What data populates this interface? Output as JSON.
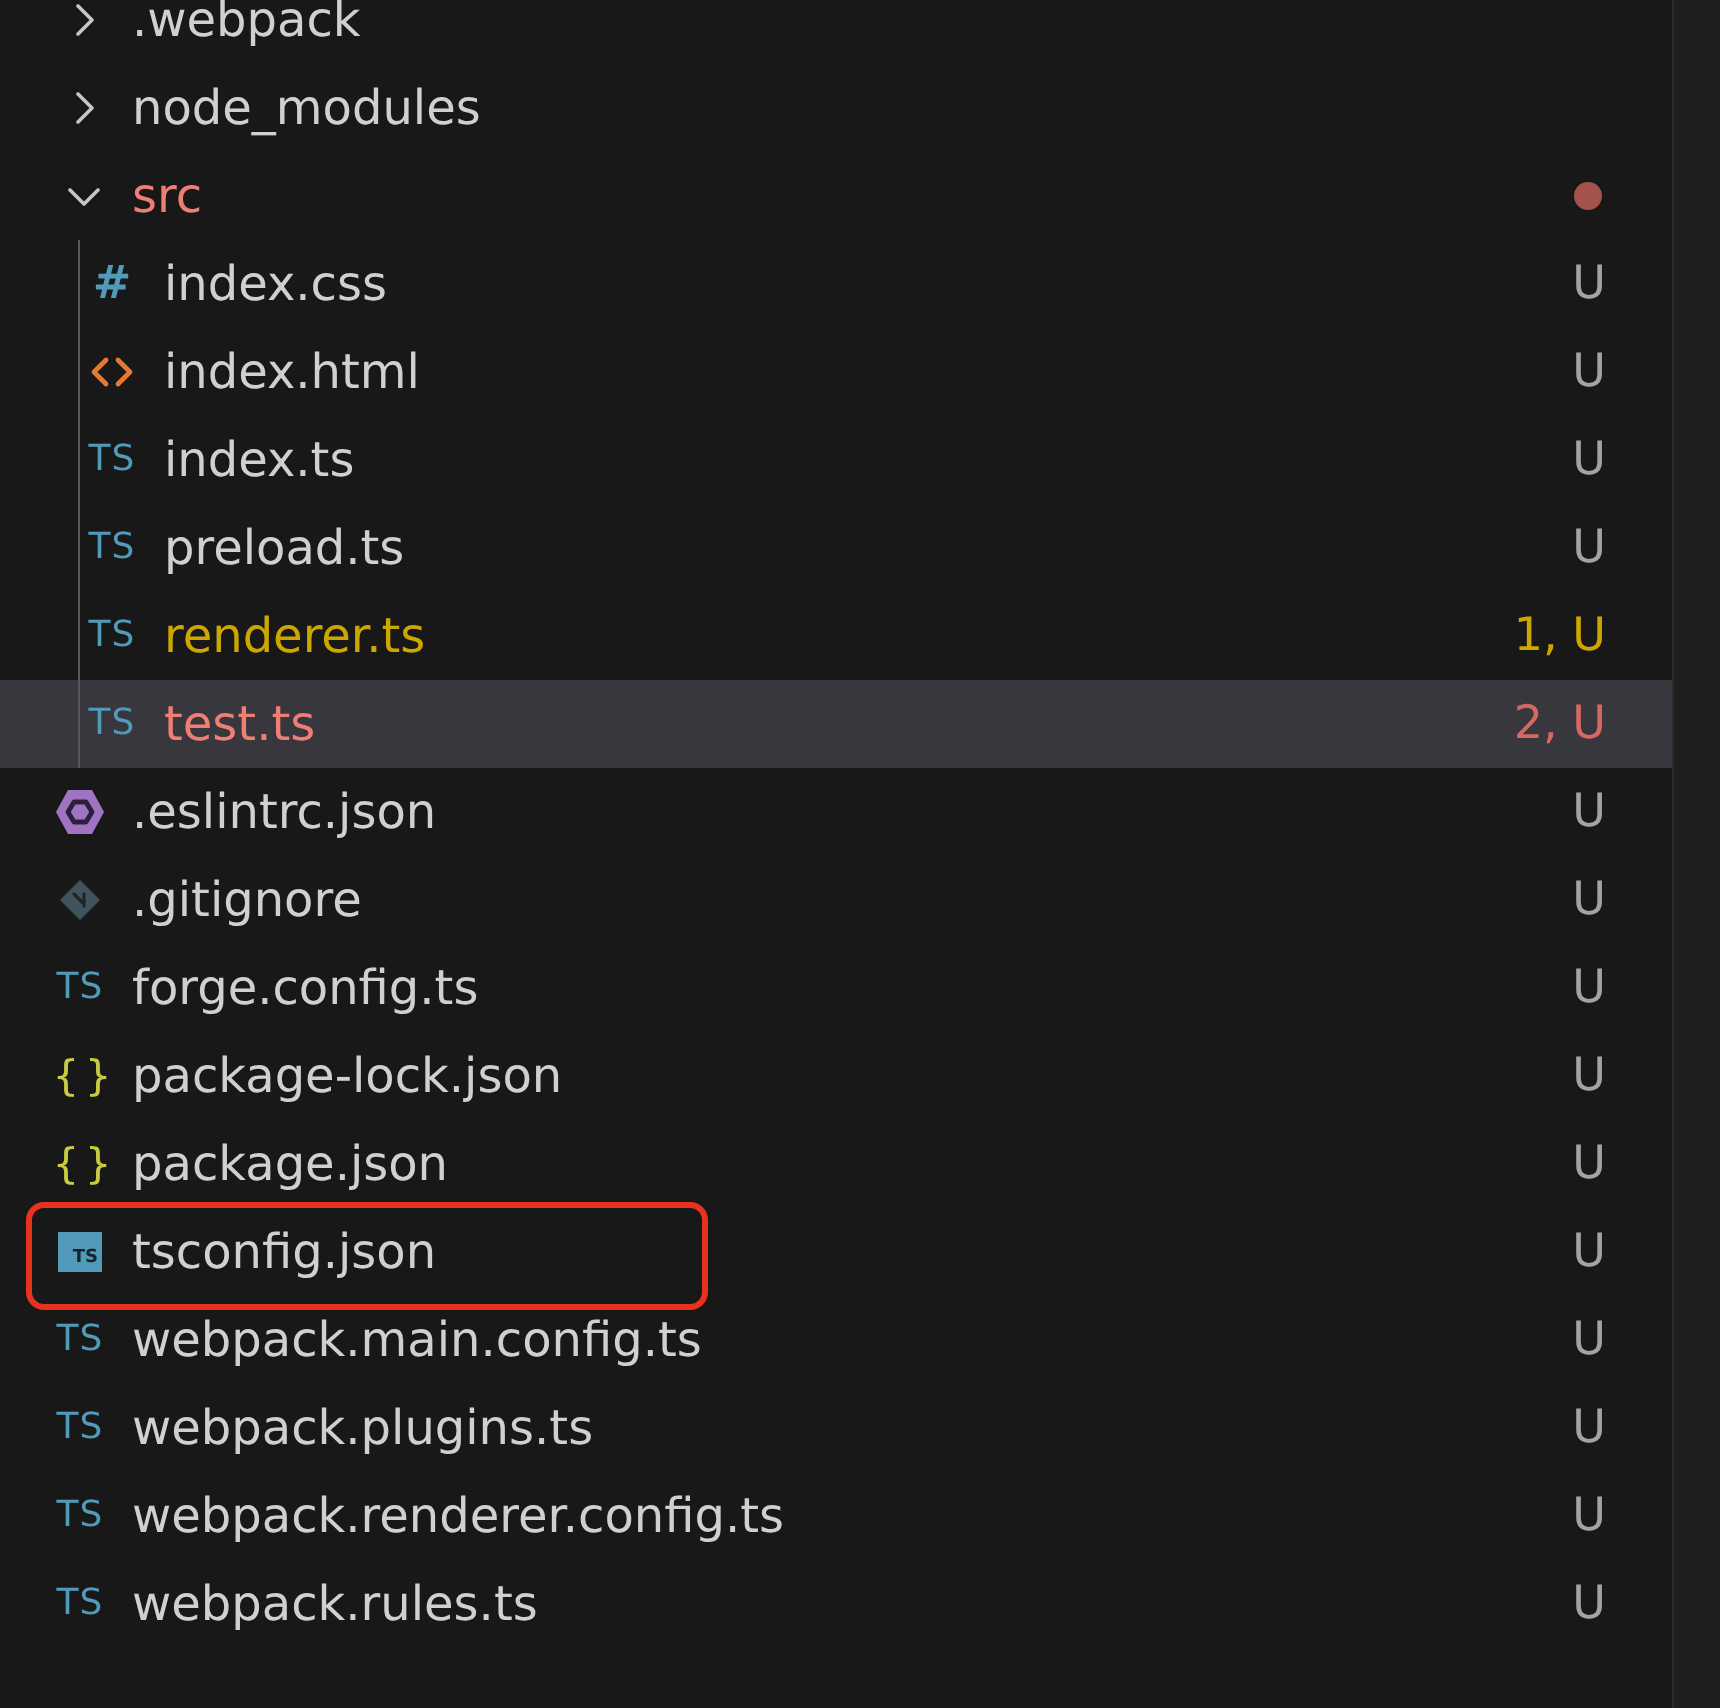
{
  "explorer": {
    "items": [
      {
        "kind": "folder",
        "name": ".webpack",
        "expanded": false,
        "selected": false,
        "highlighted": false,
        "error": false,
        "warning": false,
        "dot": false
      },
      {
        "kind": "folder",
        "name": "node_modules",
        "expanded": false,
        "selected": false,
        "highlighted": false,
        "error": false,
        "warning": false,
        "dot": false
      },
      {
        "kind": "folder",
        "name": "src",
        "expanded": true,
        "selected": false,
        "highlighted": false,
        "error": true,
        "warning": false,
        "dot": true,
        "children": [
          {
            "kind": "css",
            "icon_glyph": "#",
            "name": "index.css",
            "badge": "U",
            "selected": false,
            "highlighted": false,
            "error": false,
            "warning": false
          },
          {
            "kind": "html",
            "name": "index.html",
            "badge": "U",
            "selected": false,
            "highlighted": false,
            "error": false,
            "warning": false
          },
          {
            "kind": "ts",
            "icon_glyph": "TS",
            "name": "index.ts",
            "badge": "U",
            "selected": false,
            "highlighted": false,
            "error": false,
            "warning": false
          },
          {
            "kind": "ts",
            "icon_glyph": "TS",
            "name": "preload.ts",
            "badge": "U",
            "selected": false,
            "highlighted": false,
            "error": false,
            "warning": false
          },
          {
            "kind": "ts",
            "icon_glyph": "TS",
            "name": "renderer.ts",
            "badge": "1, U",
            "selected": false,
            "highlighted": false,
            "error": false,
            "warning": true
          },
          {
            "kind": "ts",
            "icon_glyph": "TS",
            "name": "test.ts",
            "badge": "2, U",
            "selected": true,
            "highlighted": false,
            "error": true,
            "warning": false
          }
        ]
      },
      {
        "kind": "eslint",
        "name": ".eslintrc.json",
        "badge": "U",
        "selected": false,
        "highlighted": false,
        "error": false,
        "warning": false
      },
      {
        "kind": "git",
        "name": ".gitignore",
        "badge": "U",
        "selected": false,
        "highlighted": false,
        "error": false,
        "warning": false
      },
      {
        "kind": "ts",
        "icon_glyph": "TS",
        "name": "forge.config.ts",
        "badge": "U",
        "selected": false,
        "highlighted": false,
        "error": false,
        "warning": false
      },
      {
        "kind": "json",
        "icon_glyph": "{ }",
        "name": "package-lock.json",
        "badge": "U",
        "selected": false,
        "highlighted": false,
        "error": false,
        "warning": false
      },
      {
        "kind": "json",
        "icon_glyph": "{ }",
        "name": "package.json",
        "badge": "U",
        "selected": false,
        "highlighted": false,
        "error": false,
        "warning": false
      },
      {
        "kind": "tsconfig",
        "icon_glyph": "TS",
        "name": "tsconfig.json",
        "badge": "U",
        "selected": false,
        "highlighted": true,
        "error": false,
        "warning": false
      },
      {
        "kind": "ts",
        "icon_glyph": "TS",
        "name": "webpack.main.config.ts",
        "badge": "U",
        "selected": false,
        "highlighted": false,
        "error": false,
        "warning": false
      },
      {
        "kind": "ts",
        "icon_glyph": "TS",
        "name": "webpack.plugins.ts",
        "badge": "U",
        "selected": false,
        "highlighted": false,
        "error": false,
        "warning": false
      },
      {
        "kind": "ts",
        "icon_glyph": "TS",
        "name": "webpack.renderer.config.ts",
        "badge": "U",
        "selected": false,
        "highlighted": false,
        "error": false,
        "warning": false
      },
      {
        "kind": "ts",
        "icon_glyph": "TS",
        "name": "webpack.rules.ts",
        "badge": "U",
        "selected": false,
        "highlighted": false,
        "error": false,
        "warning": false
      }
    ]
  }
}
